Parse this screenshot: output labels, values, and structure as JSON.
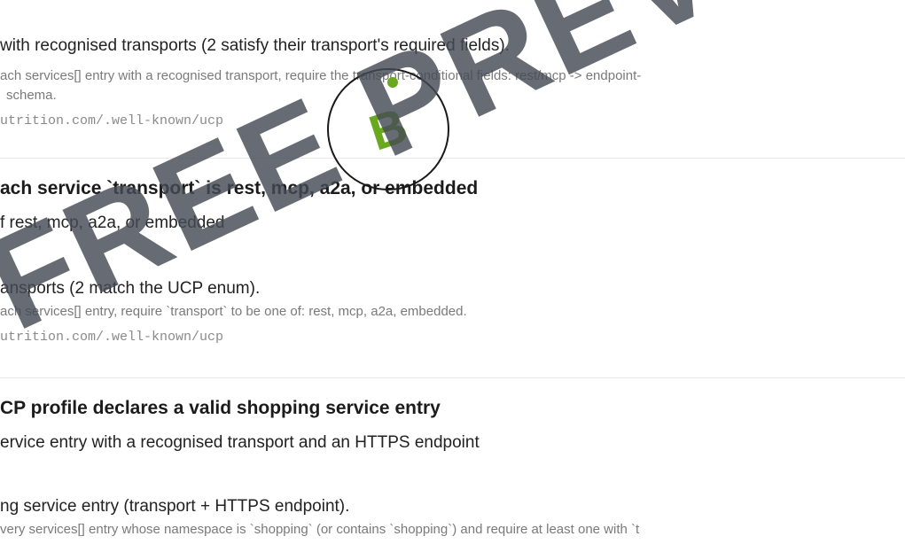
{
  "checks": [
    {
      "summary": "with recognised transports (2 satisfy their transport's required fields).",
      "detail": "ach services[] entry with a recognised transport, require the transport-conditional fields: rest/mcp -> endpoint-",
      "detail2": "schema.",
      "url": "utrition.com/.well-known/ucp"
    },
    {
      "title": "ach service `transport` is rest, mcp, a2a, or embedded",
      "subtitle": "f rest, mcp, a2a, or embedded",
      "summary": "ansports (2 match the UCP enum).",
      "detail": "ach services[] entry, require `transport` to be one of: rest, mcp, a2a, embedded.",
      "url": "utrition.com/.well-known/ucp"
    },
    {
      "title": "CP profile declares a valid shopping service entry",
      "subtitle": "ervice entry with a recognised transport and an HTTPS endpoint",
      "summary": "ng service entry (transport + HTTPS endpoint).",
      "detail": "very services[] entry whose namespace is `shopping` (or contains `shopping`) and require at least one with `t"
    }
  ],
  "badge": {
    "letter": "B",
    "accent": "#6aa81e"
  },
  "watermark": {
    "text": "FREE PREVIEW",
    "color": "#464a54"
  }
}
